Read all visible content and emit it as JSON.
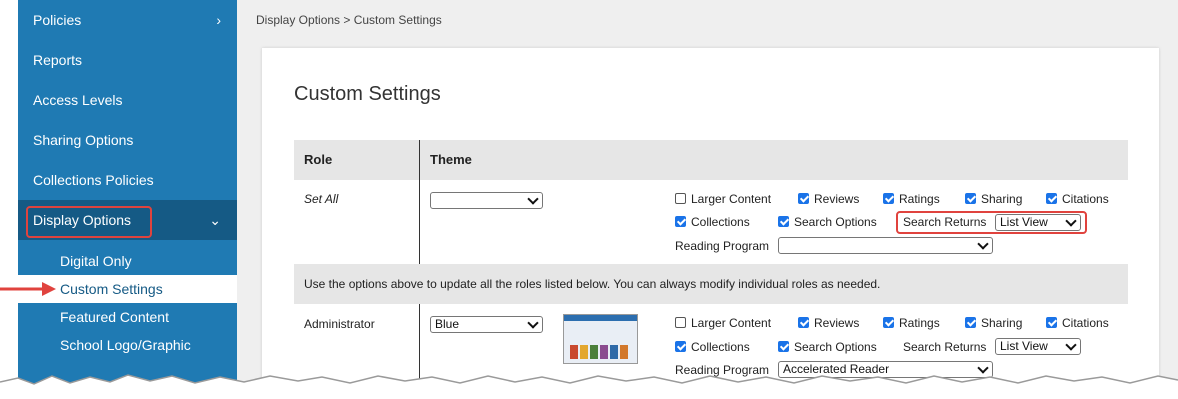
{
  "sidebar": {
    "items": [
      {
        "label": "Policies",
        "chevron": "›"
      },
      {
        "label": "Reports"
      },
      {
        "label": "Access Levels"
      },
      {
        "label": "Sharing Options"
      },
      {
        "label": "Collections Policies"
      },
      {
        "label": "Display Options",
        "chevron": "⌄"
      }
    ],
    "sub_items": [
      "Digital Only",
      "Custom Settings",
      "Featured Content",
      "School Logo/Graphic"
    ]
  },
  "breadcrumb": "Display Options >  Custom Settings",
  "page_title": "Custom Settings",
  "table": {
    "headers": {
      "role": "Role",
      "theme": "Theme"
    },
    "note": "Use the options above to update all the roles listed below. You can always modify individual roles as needed.",
    "set_all": {
      "role": "Set All",
      "theme": "",
      "options": [
        {
          "label": "Larger Content",
          "checked": false
        },
        {
          "label": "Reviews",
          "checked": true
        },
        {
          "label": "Ratings",
          "checked": true
        },
        {
          "label": "Sharing",
          "checked": true
        },
        {
          "label": "Citations",
          "checked": true
        },
        {
          "label": "Collections",
          "checked": true
        },
        {
          "label": "Search Options",
          "checked": true
        }
      ],
      "search_returns_label": "Search Returns",
      "search_returns_value": "List View",
      "reading_program_label": "Reading Program",
      "reading_program_value": ""
    },
    "administrator": {
      "role": "Administrator",
      "theme": "Blue",
      "options": [
        {
          "label": "Larger Content",
          "checked": false
        },
        {
          "label": "Reviews",
          "checked": true
        },
        {
          "label": "Ratings",
          "checked": true
        },
        {
          "label": "Sharing",
          "checked": true
        },
        {
          "label": "Citations",
          "checked": true
        },
        {
          "label": "Collections",
          "checked": true
        },
        {
          "label": "Search Options",
          "checked": true
        }
      ],
      "search_returns_label": "Search Returns",
      "search_returns_value": "List View",
      "reading_program_label": "Reading Program",
      "reading_program_value": "Accelerated Reader"
    }
  },
  "colors": {
    "sidebar": "#1f7ab3",
    "sidebar_active": "#155a85",
    "highlight": "#e0433e",
    "checkbox": "#1a73e8"
  }
}
